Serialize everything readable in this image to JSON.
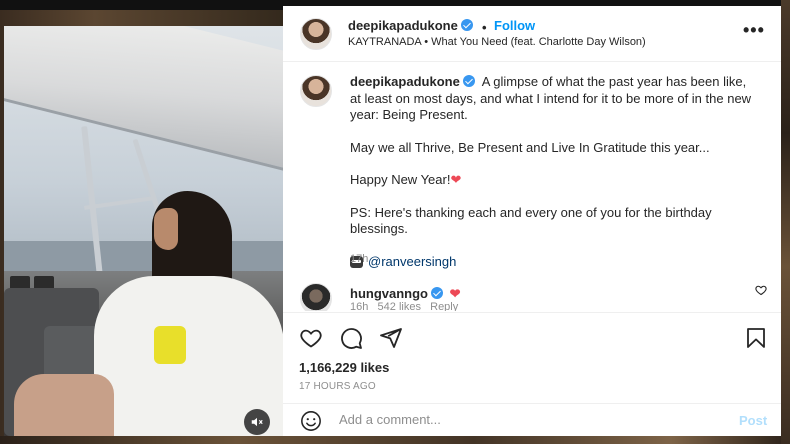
{
  "post": {
    "username": "deepikapadukone",
    "follow_label": "Follow",
    "separator": "•",
    "audio": "KAYTRANADA • What You Need (feat. Charlotte Day Wilson)",
    "more_label": "•••"
  },
  "caption": {
    "username": "deepikapadukone",
    "lead": "A glimpse of what the past year has been like, at least on most days, and what I intend for it to be more of in the new year: Being Present.",
    "line2": "May we all Thrive, Be Present and Live In Gratitude this year...",
    "line3": "Happy New Year!",
    "line4": "PS: Here's thanking each and every one of you for the birthday blessings.",
    "mention": "@ranveersingh",
    "time": "17h"
  },
  "comment": {
    "username": "hungvanngo",
    "meta_time": "16h",
    "meta_likes": "542 likes",
    "meta_reply": "Reply"
  },
  "stats": {
    "likes": "1,166,229 likes",
    "posted": "17 HOURS AGO"
  },
  "composer": {
    "placeholder": "Add a comment...",
    "post_label": "Post"
  },
  "icons": [
    "more-options-icon",
    "verified-badge-icon",
    "heart-icon",
    "comment-icon",
    "share-icon",
    "bookmark-icon",
    "emoji-icon",
    "mute-icon"
  ],
  "colors": {
    "link_blue": "#0095f6",
    "verified_blue": "#3897f0",
    "heart_red": "#ed4956",
    "mention": "#00376b",
    "muted_text": "#8e8e8e",
    "post_disabled": "#b2dffc"
  }
}
